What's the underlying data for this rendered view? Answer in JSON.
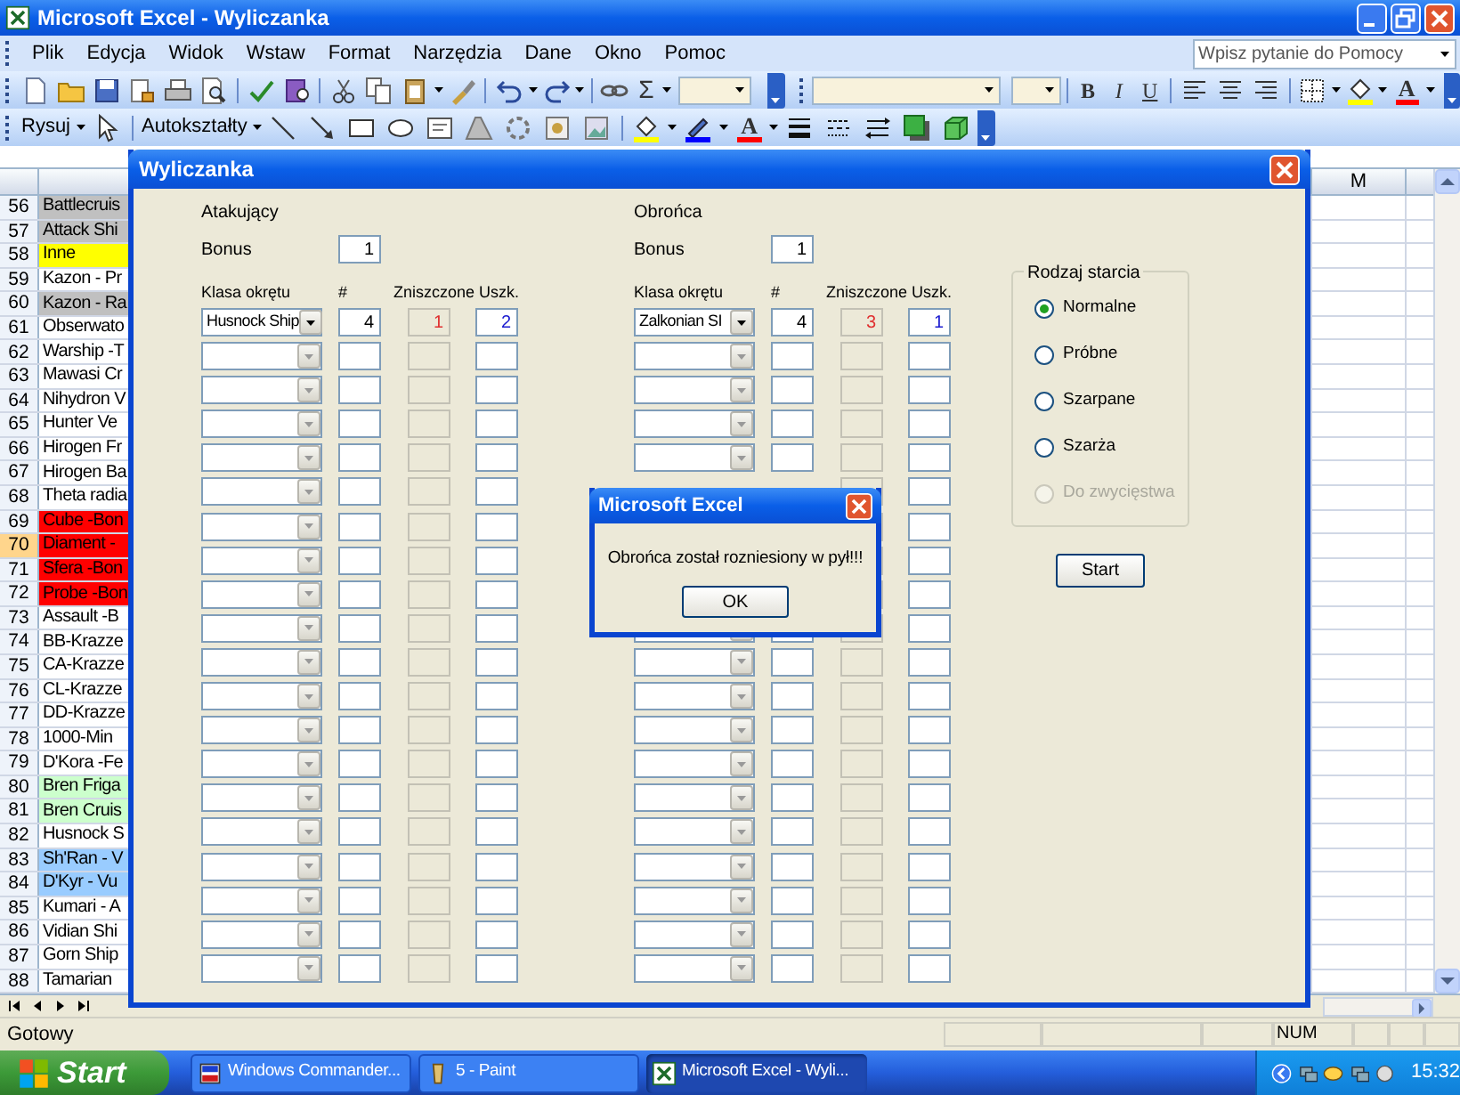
{
  "window": {
    "title": "Microsoft Excel - Wyliczanka"
  },
  "menu": [
    "Plik",
    "Edycja",
    "Widok",
    "Wstaw",
    "Format",
    "Narzędzia",
    "Dane",
    "Okno",
    "Pomoc"
  ],
  "help_box": {
    "placeholder": "Wpisz pytanie do Pomocy"
  },
  "standard_toolbar": {
    "autosum": "Σ"
  },
  "formatting_toolbar": {
    "buttons": [
      "B",
      "I",
      "U"
    ],
    "font_color": "A"
  },
  "drawing_toolbar": {
    "draw_menu": "Rysuj",
    "autoshapes_menu": "Autokształty",
    "font_color": "A"
  },
  "sheet": {
    "column_header": "M",
    "rows": [
      {
        "number": "56",
        "text": "Battlecruis",
        "color": "#c0c0c0",
        "selected": false
      },
      {
        "number": "57",
        "text": "Attack Shi",
        "color": "#c0c0c0",
        "selected": false
      },
      {
        "number": "58",
        "text": "Inne",
        "color": "#ffff00",
        "selected": false
      },
      {
        "number": "59",
        "text": "Kazon - Pr",
        "selected": false
      },
      {
        "number": "60",
        "text": "Kazon - Ra",
        "color": "#c0c0c0",
        "selected": false
      },
      {
        "number": "61",
        "text": "Obserwato",
        "selected": false
      },
      {
        "number": "62",
        "text": "Warship -T",
        "selected": false
      },
      {
        "number": "63",
        "text": "Mawasi Cr",
        "selected": false
      },
      {
        "number": "64",
        "text": "Nihydron V",
        "selected": false
      },
      {
        "number": "65",
        "text": "Hunter Ve",
        "selected": false
      },
      {
        "number": "66",
        "text": "Hirogen Fr",
        "selected": false
      },
      {
        "number": "67",
        "text": "Hirogen Ba",
        "selected": false
      },
      {
        "number": "68",
        "text": "Theta radia",
        "selected": false
      },
      {
        "number": "69",
        "text": "Cube -Bon",
        "color": "#ff0000",
        "selected": false
      },
      {
        "number": "70",
        "text": "Diament -",
        "color": "#ff0000",
        "selected": true
      },
      {
        "number": "71",
        "text": "Sfera -Bon",
        "color": "#ff0000",
        "selected": false
      },
      {
        "number": "72",
        "text": "Probe -Bon",
        "color": "#ff0000",
        "selected": false
      },
      {
        "number": "73",
        "text": "Assault -B",
        "selected": false
      },
      {
        "number": "74",
        "text": "BB-Krazze",
        "selected": false
      },
      {
        "number": "75",
        "text": "CA-Krazze",
        "selected": false
      },
      {
        "number": "76",
        "text": "CL-Krazze",
        "selected": false
      },
      {
        "number": "77",
        "text": "DD-Krazze",
        "selected": false
      },
      {
        "number": "78",
        "text": "1000-Min",
        "selected": false
      },
      {
        "number": "79",
        "text": "D'Kora -Fe",
        "selected": false
      },
      {
        "number": "80",
        "text": "Bren Friga",
        "color": "#ccffcc",
        "selected": false
      },
      {
        "number": "81",
        "text": "Bren Cruis",
        "color": "#ccffcc",
        "selected": false
      },
      {
        "number": "82",
        "text": "Husnock S",
        "selected": false
      },
      {
        "number": "83",
        "text": "Sh'Ran - V",
        "color": "#99ccff",
        "selected": false
      },
      {
        "number": "84",
        "text": "D'Kyr - Vu",
        "color": "#99ccff",
        "selected": false
      },
      {
        "number": "85",
        "text": "Kumari - A",
        "selected": false
      },
      {
        "number": "86",
        "text": "Vidian Shi",
        "selected": false
      },
      {
        "number": "87",
        "text": "Gorn Ship",
        "selected": false
      },
      {
        "number": "88",
        "text": "Tamarian",
        "selected": false
      }
    ]
  },
  "dialog": {
    "title": "Wyliczanka",
    "sides": [
      {
        "title": "Atakujący",
        "bonus_label": "Bonus",
        "bonus": "1",
        "headers": [
          "Klasa okrętu",
          "#",
          "Zniszczone",
          "Uszk."
        ],
        "rows": [
          {
            "ship": "Husnock Ship",
            "count": "4",
            "destroyed": "1",
            "damaged": "2"
          },
          {},
          {},
          {},
          {},
          {},
          {},
          {},
          {},
          {},
          {},
          {},
          {},
          {},
          {},
          {},
          {},
          {},
          {},
          {}
        ]
      },
      {
        "title": "Obrońca",
        "bonus_label": "Bonus",
        "bonus": "1",
        "headers": [
          "Klasa okrętu",
          "#",
          "Zniszczone",
          "Uszk."
        ],
        "rows": [
          {
            "ship": "Zalkonian SI",
            "count": "4",
            "destroyed": "3",
            "damaged": "1"
          },
          {},
          {},
          {},
          {},
          {},
          {},
          {},
          {},
          {},
          {},
          {},
          {},
          {},
          {},
          {},
          {},
          {},
          {},
          {}
        ]
      }
    ],
    "battle_type": {
      "title": "Rodzaj starcia",
      "options": [
        {
          "label": "Normalne",
          "selected": true,
          "disabled": false
        },
        {
          "label": "Próbne",
          "selected": false,
          "disabled": false
        },
        {
          "label": "Szarpane",
          "selected": false,
          "disabled": false
        },
        {
          "label": "Szarża",
          "selected": false,
          "disabled": false
        },
        {
          "label": "Do zwycięstwa",
          "selected": false,
          "disabled": true
        }
      ]
    },
    "start_button": "Start"
  },
  "message_box": {
    "title": "Microsoft Excel",
    "message": "Obrońca został rozniesiony w pył!!!",
    "button": "OK"
  },
  "status_bar": {
    "text": "Gotowy",
    "num": "NUM"
  },
  "taskbar": {
    "start": "Start",
    "tasks": [
      {
        "label": "Windows Commander...",
        "selected": false
      },
      {
        "label": "5 - Paint",
        "selected": false
      },
      {
        "label": "Microsoft Excel - Wyli...",
        "selected": true
      }
    ],
    "clock": "15:32"
  }
}
